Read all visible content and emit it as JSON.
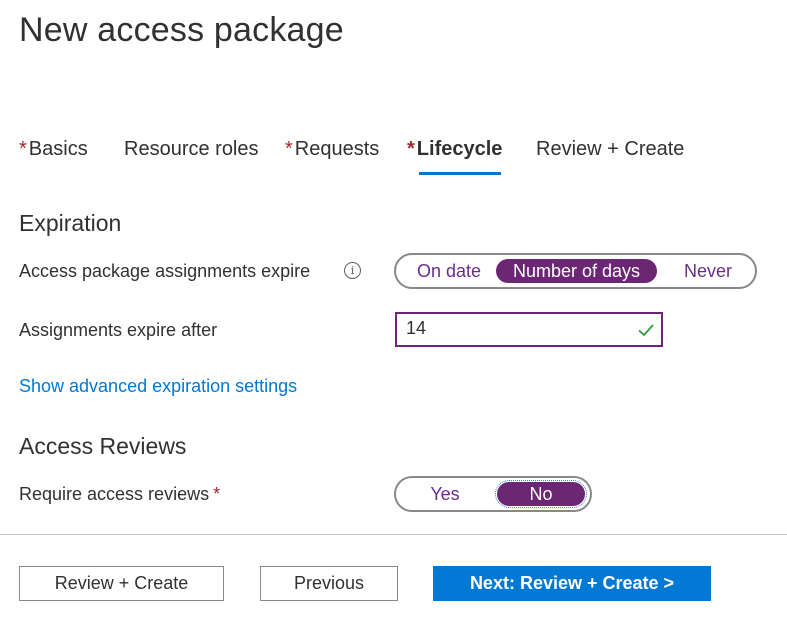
{
  "header": {
    "title": "New access package"
  },
  "tabs": [
    {
      "label": "Basics",
      "required": "*",
      "active": false
    },
    {
      "label": "Resource roles",
      "required": "",
      "active": false
    },
    {
      "label": "Requests",
      "required": "*",
      "active": false
    },
    {
      "label": "Lifecycle",
      "required": "*",
      "active": true
    },
    {
      "label": "Review + Create",
      "required": "",
      "active": false
    }
  ],
  "expiration": {
    "heading": "Expiration",
    "expire_label": "Access package assignments expire",
    "info_icon": "info-icon",
    "options": [
      "On date",
      "Number of days",
      "Never"
    ],
    "selected": "Number of days",
    "after_label": "Assignments expire after",
    "after_value": "14",
    "valid_icon": "check-icon",
    "advanced_link": "Show advanced expiration settings"
  },
  "reviews": {
    "heading": "Access Reviews",
    "require_label": "Require access reviews",
    "required_mark": "*",
    "options": [
      "Yes",
      "No"
    ],
    "selected": "No"
  },
  "footer": {
    "review_create": "Review + Create",
    "previous": "Previous",
    "next": "Next: Review + Create >"
  },
  "colors": {
    "accent_blue": "#0078d4",
    "selected_purple": "#6b2774",
    "required_red": "#a4262c"
  }
}
